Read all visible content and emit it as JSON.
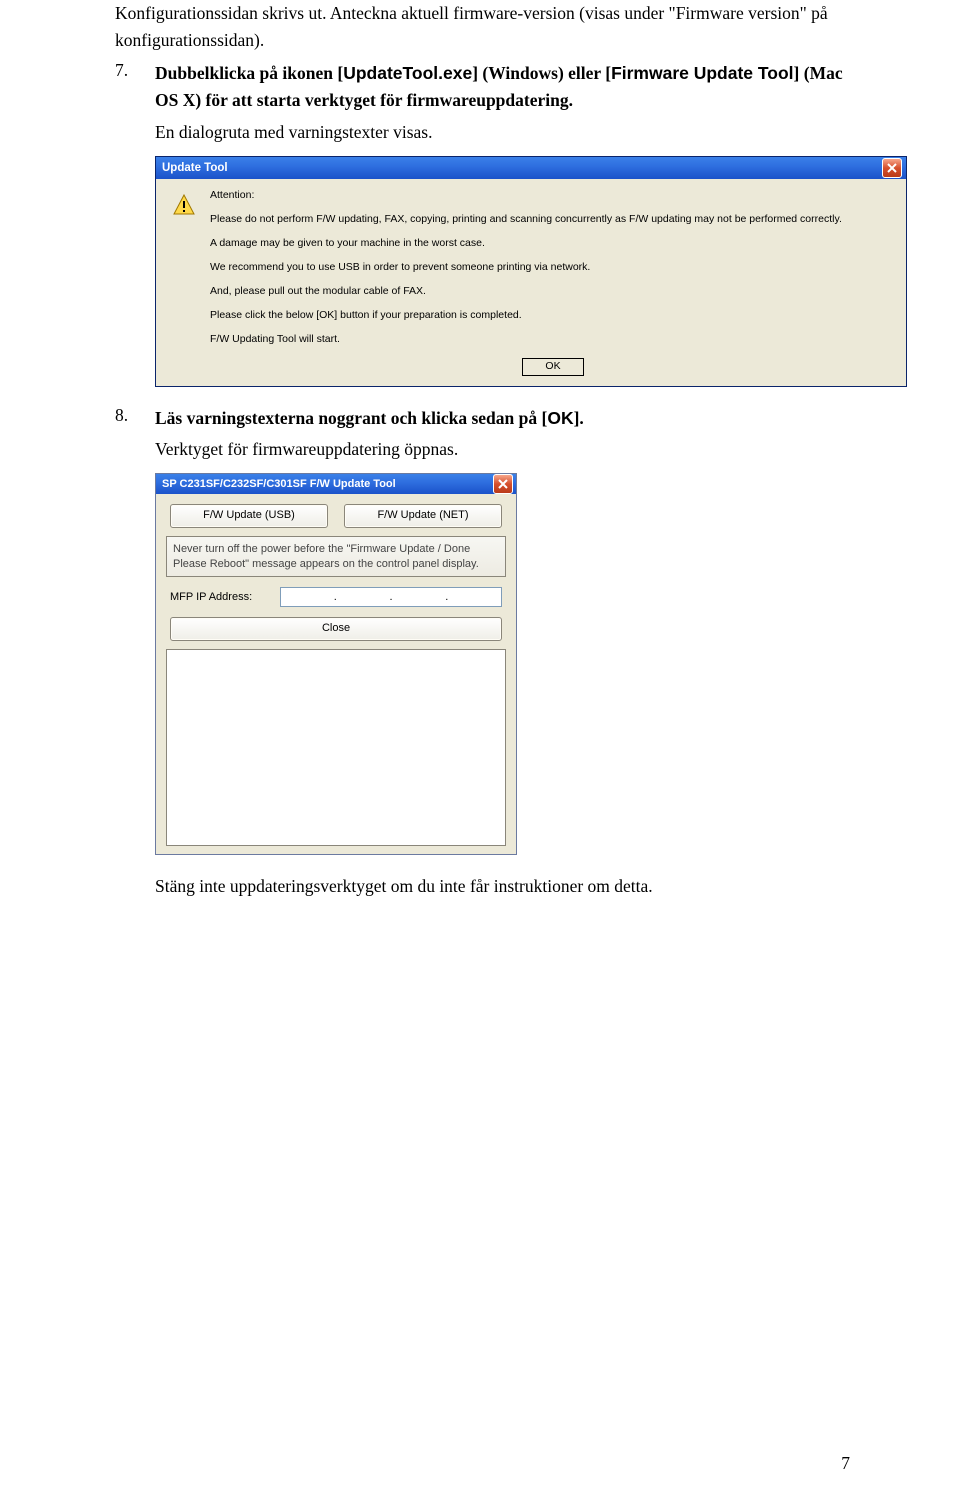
{
  "intro": "Konfigurationssidan skrivs ut. Anteckna aktuell firmware-version (visas under \"Firmware version\" på konfigurationssidan).",
  "step7": {
    "num": "7.",
    "part1": "Dubbelklicka på ikonen [",
    "token1": "UpdateTool.exe",
    "part2": "] (Windows) eller [",
    "token2": "Firmware Update Tool",
    "part3": "] (Mac OS X) för att starta verktyget för firmwareuppdatering.",
    "line2": "En dialogruta med varningstexter visas."
  },
  "dialog1": {
    "title": "Update Tool",
    "attention": "Attention:",
    "l1": "Please do not perform F/W updating, FAX, copying, printing and scanning concurrently as F/W updating may not be performed correctly.",
    "l2": "A damage may be given to your machine in the worst case.",
    "l3": "We recommend you to use USB in order to prevent someone printing via network.",
    "l4": "And, please pull out the modular cable of FAX.",
    "l5": "Please click the below [OK] button if your preparation is completed.",
    "l6": "F/W Updating Tool will start.",
    "ok": "OK"
  },
  "step8": {
    "num": "8.",
    "part1": "Läs varningstexterna noggrant och klicka sedan på [",
    "token1": "OK",
    "part2": "].",
    "line2": "Verktyget för firmwareuppdatering öppnas."
  },
  "dialog2": {
    "title": "SP C231SF/C232SF/C301SF F/W Update Tool",
    "btn_usb": "F/W Update (USB)",
    "btn_net": "F/W Update (NET)",
    "msg": "Never turn off the power before the \"Firmware Update / Done Please Reboot\" message appears on the control panel display.",
    "ip_label": "MFP IP Address:",
    "ip_sep": ".",
    "close": "Close"
  },
  "after8": "Stäng inte uppdateringsverktyget om du inte får instruktioner om detta.",
  "page_number": "7"
}
